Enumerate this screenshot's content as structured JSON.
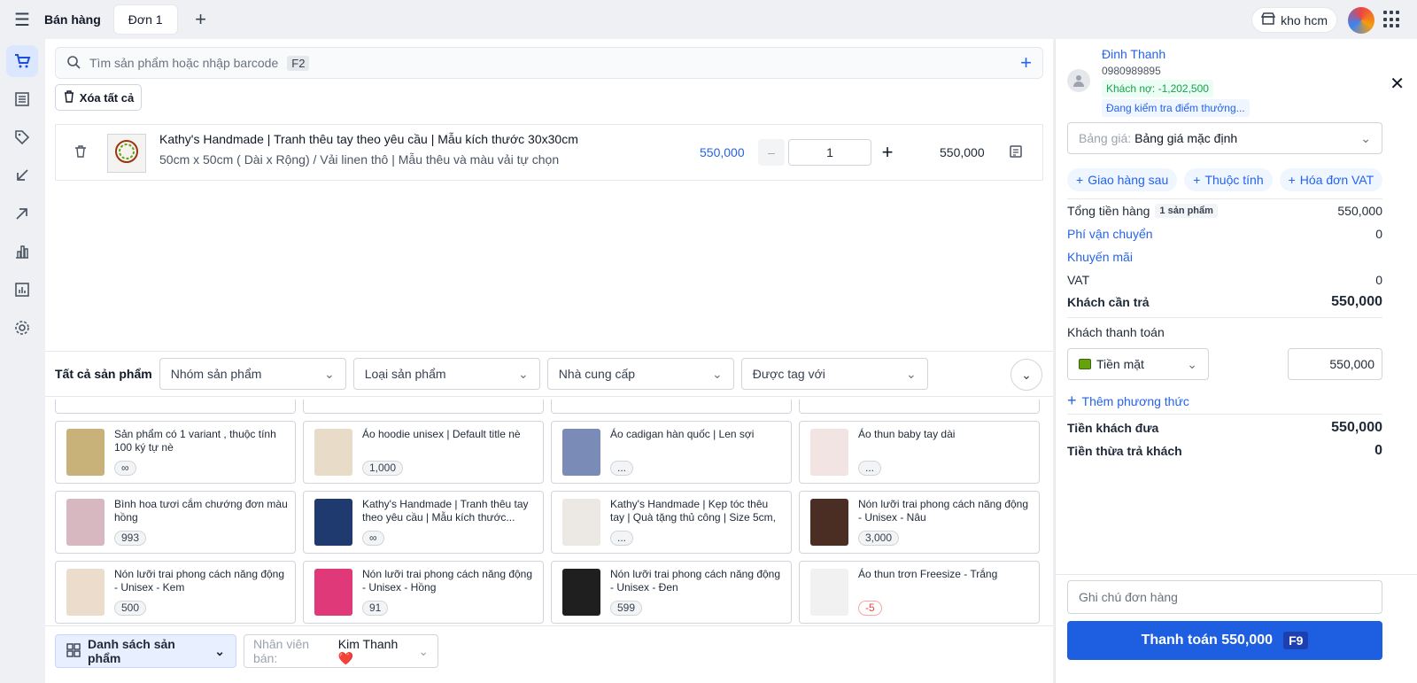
{
  "app": {
    "title": "Bán hàng",
    "tab": "Đơn 1",
    "store": "kho hcm"
  },
  "search": {
    "placeholder": "Tìm sản phẩm hoặc nhập barcode",
    "shortcut": "F2"
  },
  "cart": {
    "clear_label": "Xóa tất cả",
    "item": {
      "name": "Kathy's Handmade | Tranh thêu tay theo yêu cầu | Mẫu kích thước 30x30cm",
      "variant": "50cm x 50cm ( Dài x Rộng) / Vải linen thô | Mẫu thêu và màu vải tự chọn",
      "price": "550,000",
      "quantity": "1",
      "total": "550,000"
    }
  },
  "filters": {
    "label": "Tất cả sản phẩm",
    "group": "Nhóm sản phẩm",
    "type": "Loại sản phẩm",
    "supplier": "Nhà cung cấp",
    "tag": "Được tag với"
  },
  "products": [
    {
      "name": "Sản phẩm có 1 variant , thuộc tính 100 ký tự nè",
      "stock": "∞",
      "color": "#c9b27a"
    },
    {
      "name": "Áo hoodie unisex | Default title nè",
      "stock": "1,000",
      "color": "#e8dcc8"
    },
    {
      "name": "Áo cadigan hàn quốc | Len sợi",
      "stock": "...",
      "color": "#7b8bb8"
    },
    {
      "name": "Áo thun baby tay dài",
      "stock": "...",
      "color": "#f3e4e4"
    },
    {
      "name": "Bình hoa tươi cắm chướng đơn màu hồng",
      "stock": "993",
      "color": "#d8b8c0"
    },
    {
      "name": "Kathy's Handmade | Tranh thêu tay theo yêu cầu | Mẫu kích thước...",
      "stock": "∞",
      "color": "#1e3a6e"
    },
    {
      "name": "Kathy's Handmade | Kẹp tóc thêu tay | Quà tặng thủ công | Size 5cm, 6c...",
      "stock": "...",
      "color": "#ece9e4"
    },
    {
      "name": "Nón lưỡi trai phong cách năng động - Unisex - Nâu",
      "stock": "3,000",
      "color": "#4a2e24"
    },
    {
      "name": "Nón lưỡi trai phong cách năng động - Unisex - Kem",
      "stock": "500",
      "color": "#ecdccb"
    },
    {
      "name": "Nón lưỡi trai phong cách năng động - Unisex - Hồng",
      "stock": "91",
      "color": "#e0397a"
    },
    {
      "name": "Nón lưỡi trai phong cách năng động - Unisex - Đen",
      "stock": "599",
      "color": "#1f1f1f"
    },
    {
      "name": "Áo thun trơn Freesize - Trắng",
      "stock": "-5",
      "color": "#f1f1f1"
    }
  ],
  "bottom": {
    "list_label": "Danh sách sản phẩm",
    "staff_label": "Nhân viên bán:",
    "staff_value": "Kim Thanh ❤️"
  },
  "customer": {
    "name": "Đinh Thanh",
    "phone": "0980989895",
    "debt": "Khách nợ: -1,202,500",
    "checking": "Đang kiểm tra điểm thưởng..."
  },
  "pricelist": {
    "label": "Bảng giá:",
    "value": "Bảng giá mặc định"
  },
  "chips": [
    "Giao hàng sau",
    "Thuộc tính",
    "Hóa đơn VAT"
  ],
  "summary": {
    "subtotal_label": "Tổng tiền hàng",
    "subtotal_count": "1 sản phẩm",
    "subtotal": "550,000",
    "shipping_label": "Phí vận chuyển",
    "shipping": "0",
    "promo_label": "Khuyến mãi",
    "vat_label": "VAT",
    "vat": "0",
    "due_label": "Khách cần trả",
    "due": "550,000",
    "pay_label": "Khách thanh toán",
    "method": "Tiền mặt",
    "method_amount": "550,000",
    "add_method": "Thêm phương thức",
    "given_label": "Tiền khách đưa",
    "given": "550,000",
    "change_label": "Tiền thừa trả khách",
    "change": "0"
  },
  "order_note_placeholder": "Ghi chú đơn hàng",
  "checkout": {
    "label": "Thanh toán 550,000",
    "shortcut": "F9"
  }
}
